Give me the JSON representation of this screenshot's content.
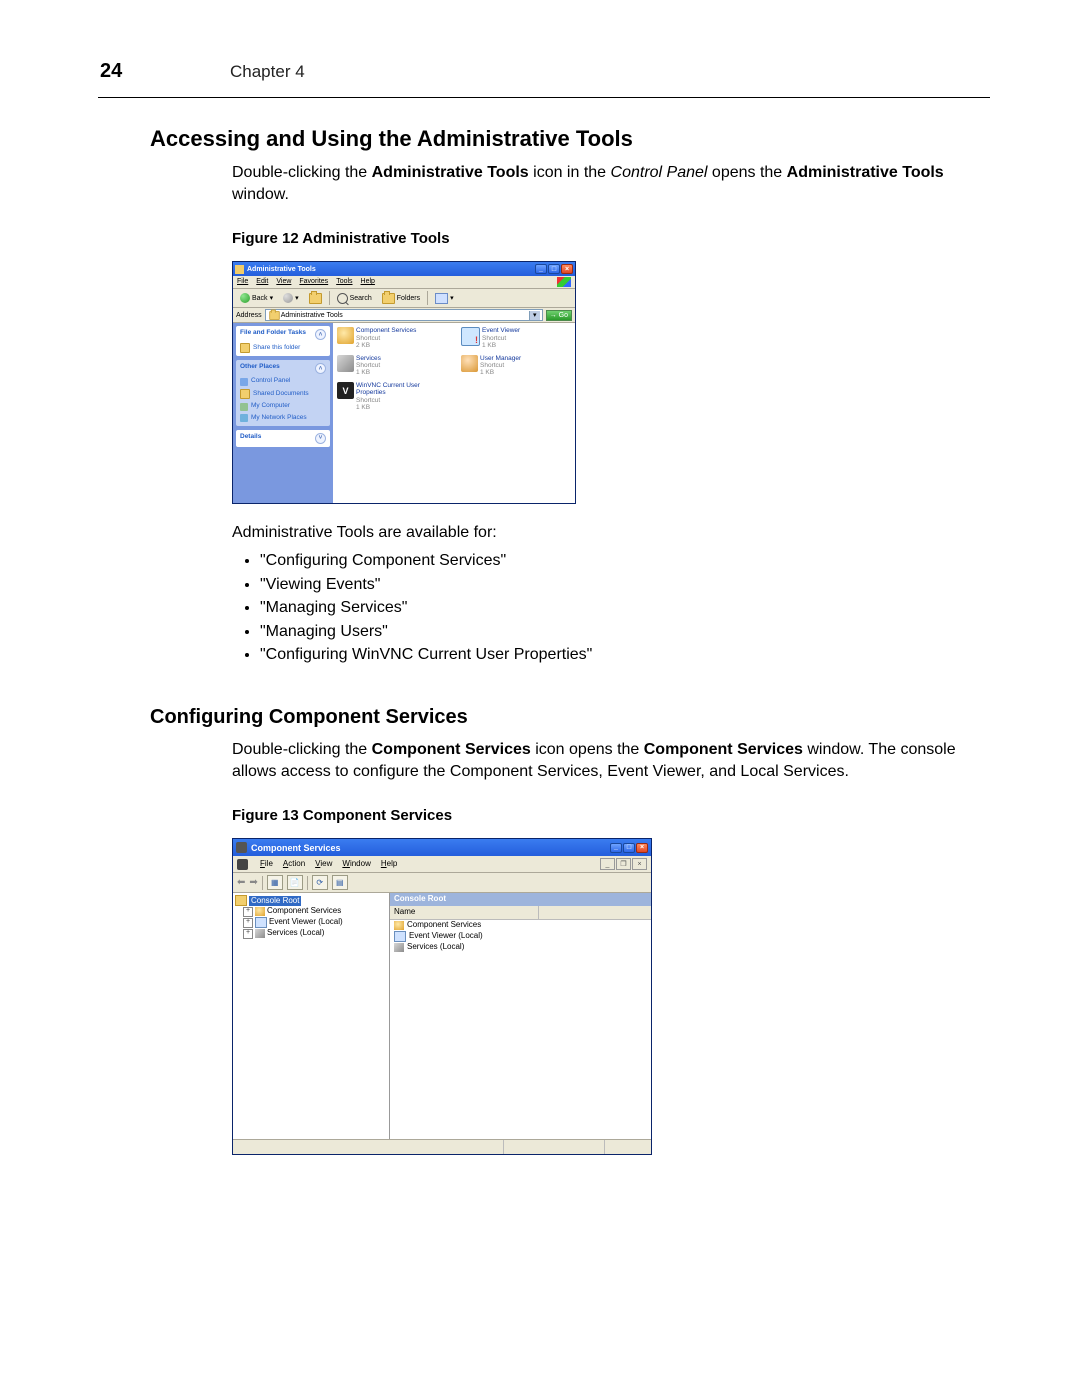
{
  "page": {
    "number": "24",
    "chapter": "Chapter 4"
  },
  "section1": {
    "heading": "Accessing and Using the Administrative Tools",
    "para_pre": "Double-clicking the ",
    "bold1": "Administrative Tools",
    "para_mid": " icon in the ",
    "ital1": "Control Panel",
    "para_mid2": " opens the ",
    "bold2": "Administrative Tools",
    "para_end": " window.",
    "figcap": "Figure 12   Administrative Tools",
    "after_fig": "Administrative Tools are available for:",
    "bullets": [
      "\"Configuring Component Services\"",
      "\"Viewing Events\"",
      "\"Managing Services\"",
      "\"Managing Users\"",
      "\"Configuring WinVNC Current User Properties\""
    ]
  },
  "section2": {
    "heading": "Configuring Component Services",
    "para_pre": "Double-clicking the ",
    "bold1": "Component Services",
    "para_mid": " icon opens the ",
    "bold2": "Component Services",
    "para_end": " window. The console allows access to configure the Component Services, Event Viewer, and Local Services.",
    "figcap": "Figure 13   Component Services"
  },
  "fig12": {
    "title": "Administrative Tools",
    "menus": [
      "File",
      "Edit",
      "View",
      "Favorites",
      "Tools",
      "Help"
    ],
    "toolbar": {
      "back": "Back",
      "search": "Search",
      "folders": "Folders"
    },
    "address_label": "Address",
    "address_value": "Administrative Tools",
    "go": "Go",
    "side": {
      "s1_title": "File and Folder Tasks",
      "s1_item": "Share this folder",
      "s2_title": "Other Places",
      "s2_items": [
        "Control Panel",
        "Shared Documents",
        "My Computer",
        "My Network Places"
      ],
      "s3_title": "Details"
    },
    "items": [
      {
        "name": "Component Services",
        "row2": "Shortcut",
        "row3": "2 KB",
        "cls": "comp"
      },
      {
        "name": "Event Viewer",
        "row2": "Shortcut",
        "row3": "1 KB",
        "cls": "ev"
      },
      {
        "name": "Services",
        "row2": "Shortcut",
        "row3": "1 KB",
        "cls": "svc"
      },
      {
        "name": "User Manager",
        "row2": "Shortcut",
        "row3": "1 KB",
        "cls": "usr"
      },
      {
        "name": "WinVNC Current User Properties",
        "row2": "Shortcut",
        "row3": "1 KB",
        "cls": "vnc"
      }
    ]
  },
  "fig13": {
    "title": "Component Services",
    "menus": [
      "File",
      "Action",
      "View",
      "Window",
      "Help"
    ],
    "tree_root": "Console Root",
    "tree_items": [
      "Component Services",
      "Event Viewer (Local)",
      "Services (Local)"
    ],
    "pane_head": "Console Root",
    "col1": "Name",
    "list": [
      "Component Services",
      "Event Viewer (Local)",
      "Services (Local)"
    ]
  }
}
